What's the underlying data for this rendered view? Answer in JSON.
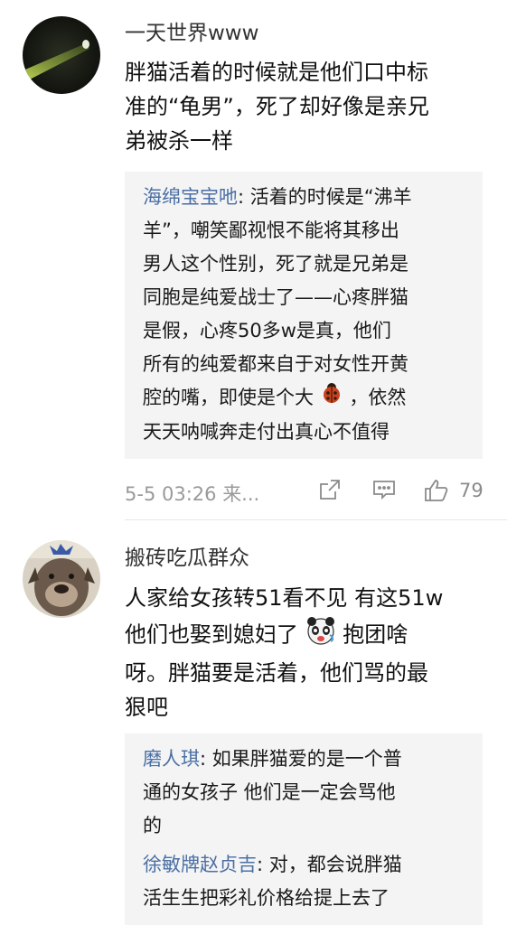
{
  "comments": [
    {
      "username": "一天世界www",
      "text_lines": [
        "胖猫活着的时候就是他们口中标",
        "准的“龟男”，死了却好像是亲兄",
        "弟被杀一样"
      ],
      "replies": [
        {
          "author": "海绵宝宝吔",
          "lines_first": ": 活着的时候是“沸羊",
          "lines": [
            "羊”，嘲笑鄙视恨不能将其移出",
            "男人这个性别，死了就是兄弟是",
            "同胞是纯爱战士了——心疼胖猫",
            "是假，心疼50多w是真，他们",
            "所有的纯爱都来自于对女性开黄"
          ],
          "line_emoji_before": "腔的嘴，即使是个大",
          "line_emoji_after": "，依然",
          "last_line": "天天呐喊奔走付出真心不值得"
        }
      ],
      "time": "5-5 03:26",
      "source_truncated": "来...",
      "like_count": "79"
    },
    {
      "username": "搬砖吃瓜群众",
      "text_line1": "人家给女孩转51看不见 有这51w",
      "text_line2_before": "他们也娶到媳妇了",
      "text_line2_after": "抱团啥",
      "text_line3": "呀。胖猫要是活着，他们骂的最",
      "text_line4": "狠吧",
      "replies": [
        {
          "author": "磨人琪",
          "first": ": 如果胖猫爱的是一个普",
          "lines": [
            "通的女孩子 他们是一定会骂他",
            "的"
          ]
        },
        {
          "author": "徐敏牌赵贞吉",
          "first": ": 对，都会说胖猫",
          "lines": [
            "活生生把彩礼价格给提上去了"
          ]
        }
      ]
    }
  ],
  "colors": {
    "author_blue": "#4a6fa5",
    "reply_bg": "#f4f4f4",
    "meta_gray": "#9a9a9a"
  },
  "icons": [
    "share-icon",
    "comment-icon",
    "like-icon",
    "ladybug-emoji",
    "panda-emoji"
  ]
}
